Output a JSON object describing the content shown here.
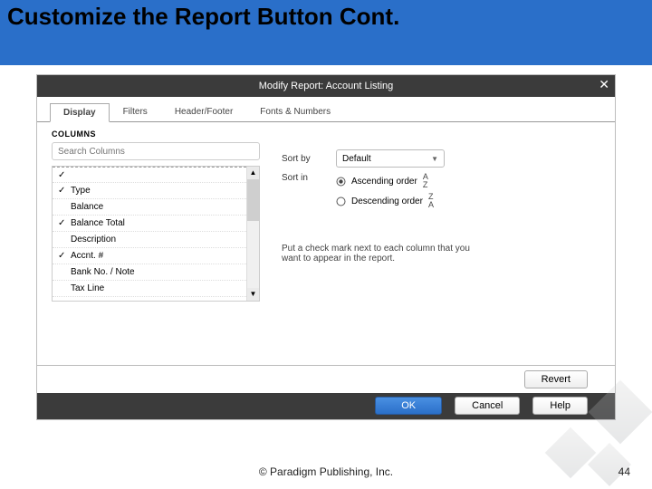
{
  "slide": {
    "title": "Customize the Report Button Cont.",
    "copyright": "© Paradigm Publishing, Inc.",
    "page_number": "44"
  },
  "modal": {
    "title": "Modify Report: Account Listing",
    "close_glyph": "✕"
  },
  "tabs": {
    "items": [
      {
        "label": "Display",
        "active": true
      },
      {
        "label": "Filters"
      },
      {
        "label": "Header/Footer"
      },
      {
        "label": "Fonts & Numbers"
      }
    ]
  },
  "columns": {
    "section_label": "COLUMNS",
    "search_placeholder": "Search Columns",
    "items": [
      {
        "checked": true,
        "label": ""
      },
      {
        "checked": true,
        "label": "Type"
      },
      {
        "checked": false,
        "label": "Balance"
      },
      {
        "checked": true,
        "label": "Balance Total"
      },
      {
        "checked": false,
        "label": "Description"
      },
      {
        "checked": true,
        "label": "Accnt. #"
      },
      {
        "checked": false,
        "label": "Bank No. / Note"
      },
      {
        "checked": false,
        "label": "Tax Line"
      }
    ]
  },
  "sort": {
    "sort_by_label": "Sort by",
    "sort_by_value": "Default",
    "sort_in_label": "Sort in",
    "asc_label": "Ascending order",
    "desc_label": "Descending order",
    "asc_glyph": "A↑\nZ↓",
    "desc_glyph": "Z↑\nA↓",
    "selected": "asc"
  },
  "hint": {
    "text": "Put a check mark next to each column that you want to appear in the report."
  },
  "buttons": {
    "revert": "Revert",
    "ok": "OK",
    "cancel": "Cancel",
    "help": "Help"
  }
}
